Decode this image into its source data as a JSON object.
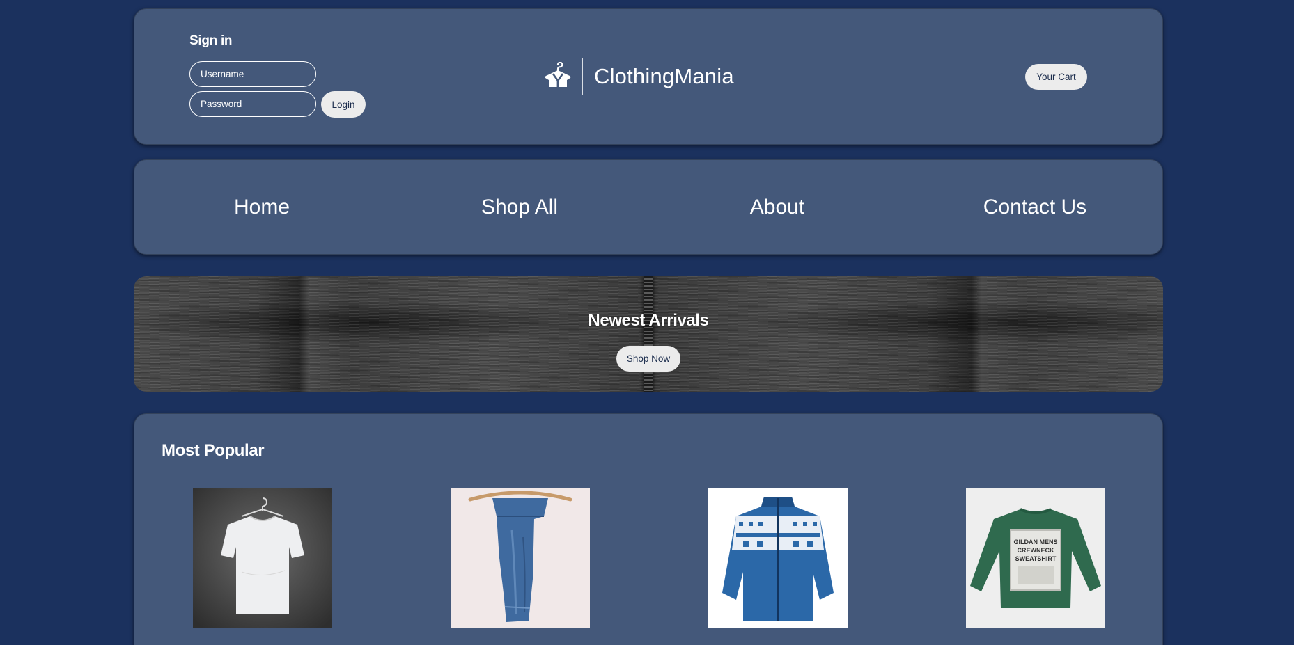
{
  "header": {
    "signin_title": "Sign in",
    "username_placeholder": "Username",
    "password_placeholder": "Password",
    "login_label": "Login",
    "brand_name": "ClothingMania",
    "brand_icon": "hanger-shirt-icon",
    "cart_label": "Your Cart"
  },
  "nav": {
    "items": [
      {
        "label": "Home"
      },
      {
        "label": "Shop All"
      },
      {
        "label": "About"
      },
      {
        "label": "Contact Us"
      }
    ]
  },
  "hero": {
    "title": "Newest Arrivals",
    "button_label": "Shop Now"
  },
  "popular": {
    "title": "Most Popular",
    "products": [
      {
        "image": "white-tshirt-on-hanger"
      },
      {
        "image": "folded-blue-jeans-on-hanger"
      },
      {
        "image": "blue-patterned-fleece-jacket"
      },
      {
        "image": "green-crewneck-sweatshirt"
      }
    ],
    "sweatshirt_print": "GILDAN MENS CREWNECK SWEATSHIRT"
  },
  "colors": {
    "page_background": "#1b315e",
    "panel_background": "#44587a",
    "button_background": "#ececec",
    "button_text": "#1c2d4d"
  }
}
